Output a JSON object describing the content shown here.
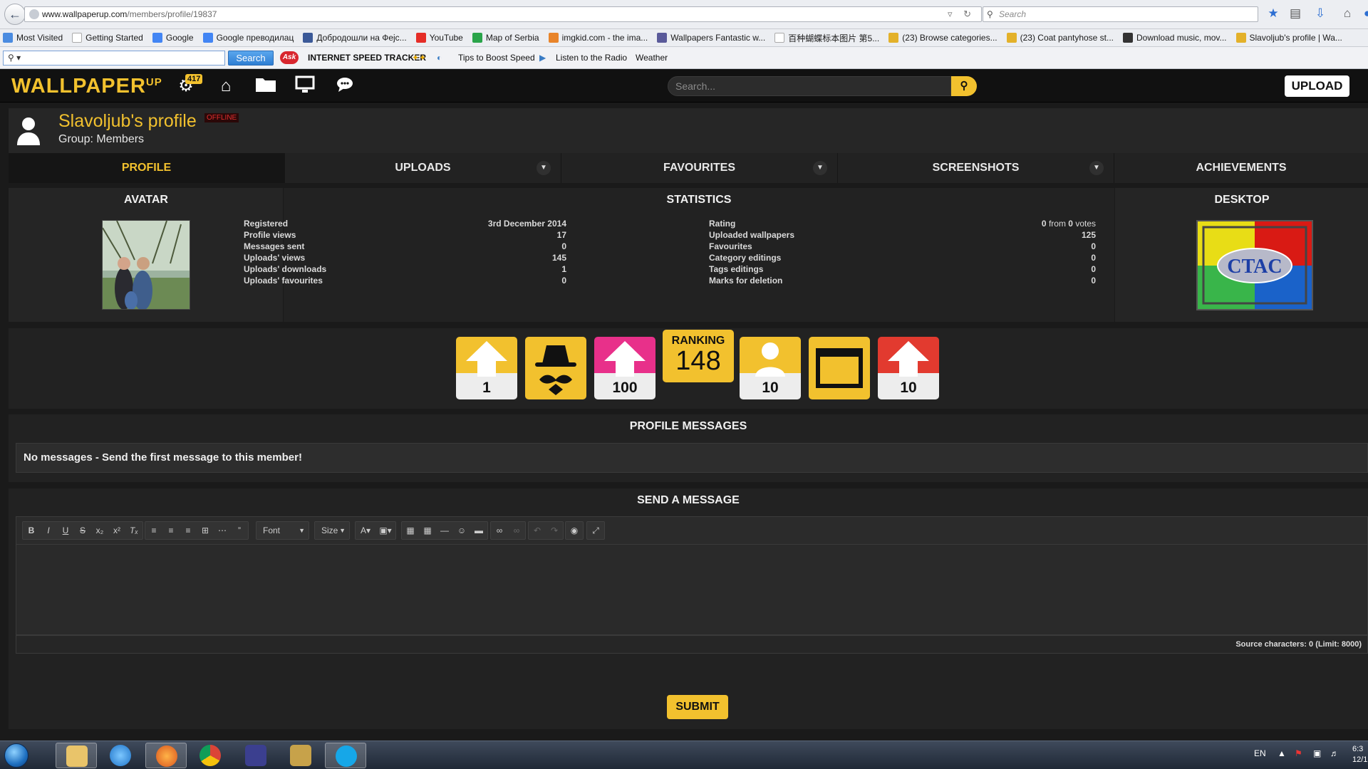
{
  "browser": {
    "url_host": "www.wallpaperup.com",
    "url_path": "/members/profile/19837",
    "search_placeholder": "Search",
    "bookmarks": [
      {
        "label": "Most Visited",
        "icon": "bookmark-icon"
      },
      {
        "label": "Getting Started",
        "icon": "page-icon"
      },
      {
        "label": "Google",
        "icon": "google-icon"
      },
      {
        "label": "Google преводилац",
        "icon": "translate-icon"
      },
      {
        "label": "Добродошли на Фејс...",
        "icon": "facebook-icon"
      },
      {
        "label": "YouTube",
        "icon": "youtube-icon"
      },
      {
        "label": "Map of Serbia",
        "icon": "map-icon"
      },
      {
        "label": "imgkid.com - the ima...",
        "icon": "imgkid-icon"
      },
      {
        "label": "Wallpapers Fantastic w...",
        "icon": "wallpaper-icon"
      },
      {
        "label": "百种蝴蝶标本图片 第5...",
        "icon": "page-icon"
      },
      {
        "label": "(23) Browse categories...",
        "icon": "folder-icon"
      },
      {
        "label": "(23) Coat pantyhose st...",
        "icon": "folder-icon"
      },
      {
        "label": "Download music, mov...",
        "icon": "download-icon"
      },
      {
        "label": "Slavoljub's profile | Wa...",
        "icon": "folder-icon"
      }
    ],
    "toolbar": {
      "search_button": "Search",
      "ask_logo": "Ask",
      "speed_tracker": "INTERNET SPEED TRACKER",
      "tips": "Tips to Boost Speed",
      "radio": "Listen to the Radio",
      "weather": "Weather"
    }
  },
  "site": {
    "logo_text": "WALLPAPER",
    "logo_sup": "UP",
    "notification_count": "417",
    "search_placeholder": "Search...",
    "upload_label": "UPLOAD"
  },
  "profile": {
    "title": "Slavoljub's profile",
    "status": "OFFLINE",
    "group": "Group: Members",
    "tabs": [
      {
        "label": "PROFILE",
        "active": true,
        "dropdown": false
      },
      {
        "label": "UPLOADS",
        "active": false,
        "dropdown": true
      },
      {
        "label": "FAVOURITES",
        "active": false,
        "dropdown": true
      },
      {
        "label": "SCREENSHOTS",
        "active": false,
        "dropdown": true
      },
      {
        "label": "ACHIEVEMENTS",
        "active": false,
        "dropdown": false
      }
    ]
  },
  "sections": {
    "avatar": "AVATAR",
    "statistics": "STATISTICS",
    "desktop": "DESKTOP",
    "profile_messages": "PROFILE MESSAGES",
    "send_message": "SEND A MESSAGE"
  },
  "stats_left": [
    {
      "label": "Registered",
      "value": "3rd December 2014"
    },
    {
      "label": "Profile views",
      "value": "17"
    },
    {
      "label": "Messages sent",
      "value": "0"
    },
    {
      "label": "Uploads' views",
      "value": "145"
    },
    {
      "label": "Uploads' downloads",
      "value": "1"
    },
    {
      "label": "Uploads' favourites",
      "value": "0"
    }
  ],
  "rating": {
    "label": "Rating",
    "num1": "0",
    "word": "from",
    "num2": "0",
    "suffix": "votes"
  },
  "stats_right": [
    {
      "label": "Uploaded wallpapers",
      "value": "125"
    },
    {
      "label": "Favourites",
      "value": "0"
    },
    {
      "label": "Category editings",
      "value": "0"
    },
    {
      "label": "Tags editings",
      "value": "0"
    },
    {
      "label": "Marks for deletion",
      "value": "0"
    }
  ],
  "desktop_thumb_text": "CTAC",
  "badges": [
    {
      "icon": "upload-arrow-icon",
      "color": "#f2c12e",
      "value": "1"
    },
    {
      "icon": "mustache-hat-icon",
      "color": "#f2c12e",
      "value": ""
    },
    {
      "icon": "upload-arrow-icon",
      "color": "#e8308a",
      "value": "100"
    },
    {
      "icon": "user-icon",
      "color": "#f2c12e",
      "value": "10"
    },
    {
      "icon": "window-icon",
      "color": "#f2c12e",
      "value": ""
    },
    {
      "icon": "upload-arrow-icon",
      "color": "#e23a2f",
      "value": "10"
    }
  ],
  "ranking": {
    "label": "RANKING",
    "value": "148"
  },
  "messages": {
    "empty_text": "No messages - Send the first message to this member!"
  },
  "editor": {
    "font_label": "Font",
    "size_label": "Size",
    "status": "Source characters: 0 (Limit: 8000)",
    "submit": "SUBMIT"
  },
  "taskbar": {
    "lang": "EN",
    "time": "6:3",
    "date": "12/1"
  }
}
